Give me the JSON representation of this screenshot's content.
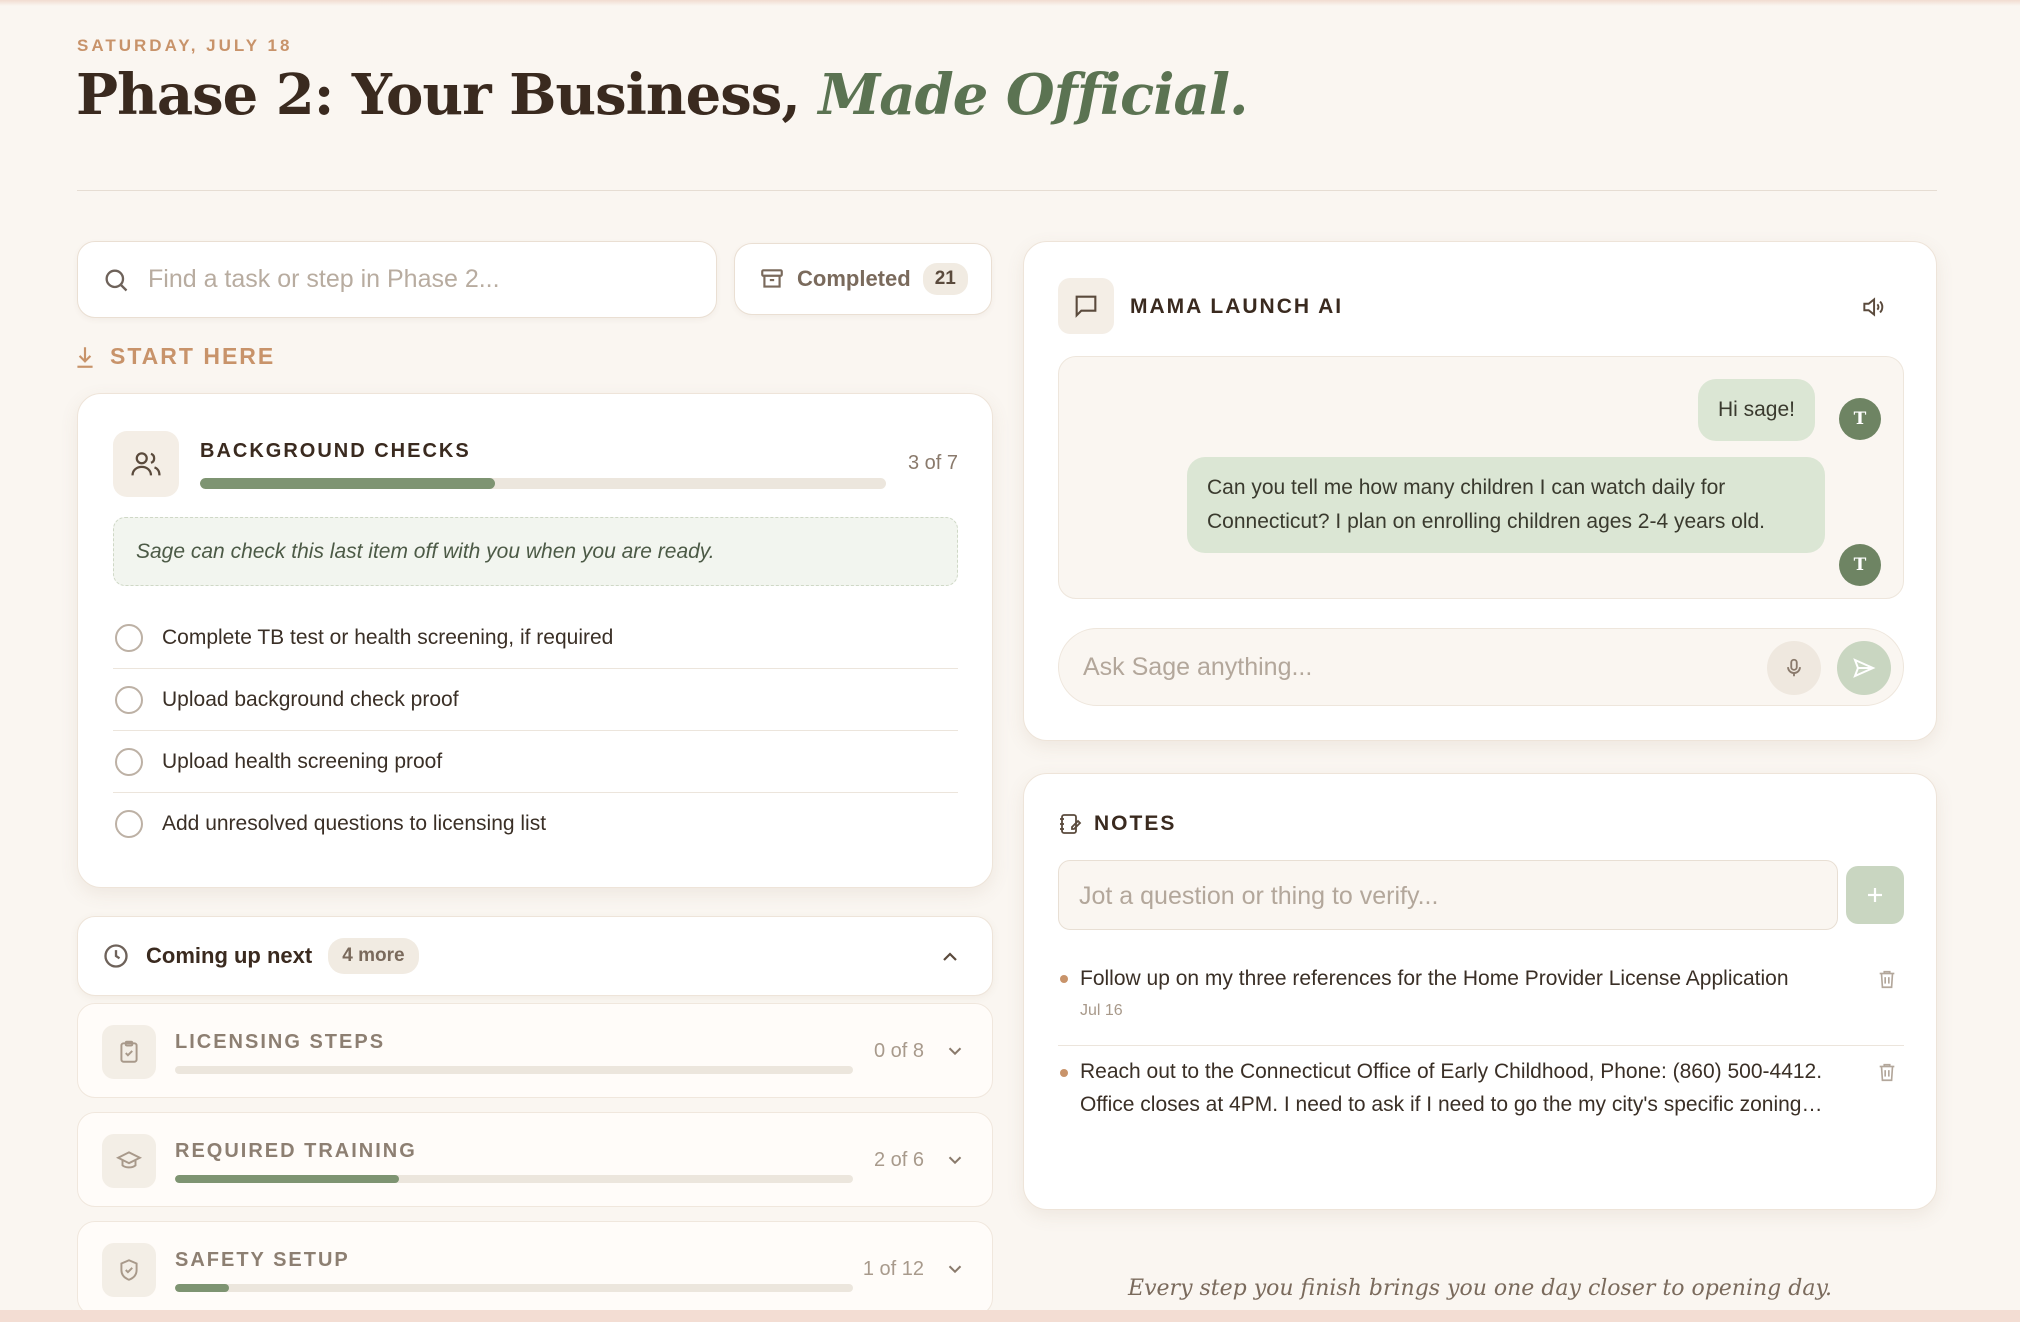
{
  "header": {
    "date": "SATURDAY, JULY 18",
    "title_main": "Phase 2: Your Business,",
    "title_italic": "Made Official."
  },
  "search": {
    "placeholder": "Find a task or step in Phase 2..."
  },
  "completed": {
    "label": "Completed",
    "count": "21"
  },
  "start_here": {
    "label": "START HERE"
  },
  "active_card": {
    "title": "BACKGROUND CHECKS",
    "progress_label": "3 of 7",
    "progress": 0.43,
    "note": "Sage can check this last item off with you when you are ready.",
    "tasks": [
      "Complete TB test or health screening, if required",
      "Upload background check proof",
      "Upload health screening proof",
      "Add unresolved questions to licensing list"
    ]
  },
  "coming_up": {
    "label": "Coming up next",
    "badge": "4 more"
  },
  "steps": [
    {
      "title": "LICENSING STEPS",
      "progress_label": "0 of 8",
      "progress": 0.0,
      "icon": "clipboard-check-icon"
    },
    {
      "title": "REQUIRED TRAINING",
      "progress_label": "2 of 6",
      "progress": 0.33,
      "icon": "graduation-cap-icon"
    },
    {
      "title": "SAFETY SETUP",
      "progress_label": "1 of 12",
      "progress": 0.08,
      "icon": "shield-check-icon"
    }
  ],
  "chat": {
    "title": "MAMA LAUNCH AI",
    "messages": [
      {
        "text": "Hi sage!",
        "avatar": "T"
      },
      {
        "text": "Can you tell me how many children I can watch daily for Connecticut? I plan on enrolling children ages 2-4 years old.",
        "avatar": "T"
      }
    ],
    "input_placeholder": "Ask Sage anything..."
  },
  "notes": {
    "title": "NOTES",
    "input_placeholder": "Jot a question or thing to verify...",
    "items": [
      {
        "text": "Follow up on my three references for the Home Provider License Application",
        "date": "Jul 16"
      },
      {
        "text": "Reach out to the Connecticut Office of Early Childhood, Phone: (860) 500-4412. Office closes at 4PM. I need to ask if I need to go the my city's specific zoning office.",
        "date": ""
      }
    ]
  },
  "footer": {
    "quote": "Every step you finish brings you one day closer to opening day."
  },
  "colors": {
    "accent_green": "#7e9472",
    "accent_tan": "#c8936a",
    "background": "#faf6f1"
  }
}
